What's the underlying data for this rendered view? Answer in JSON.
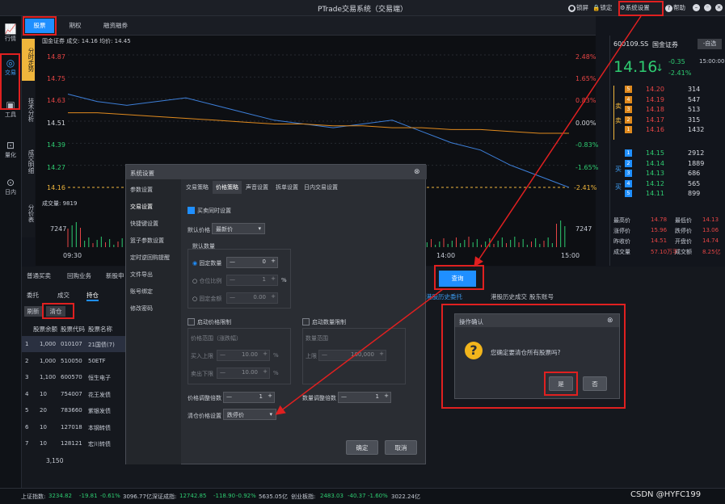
{
  "titlebar": {
    "title": "PTrade交易系统（交易端）",
    "menu": [
      "锁屏",
      "锁定",
      "系统设置",
      "帮助"
    ]
  },
  "leftbar": {
    "items": [
      "行情",
      "交易",
      "工具",
      "量化",
      "日内"
    ]
  },
  "subtabs": [
    "股票",
    "期权",
    "融资融券"
  ],
  "vtabs": [
    "分时走势",
    "技术分析",
    "成交明细",
    "分价表"
  ],
  "chart": {
    "legend": "国金证券 成交: 14.16 均价: 14.45",
    "yticks": [
      "14.87",
      "14.75",
      "14.63",
      "14.51",
      "14.39",
      "14.27",
      "14.16"
    ],
    "pct": [
      "2.48%",
      "1.65%",
      "0.83%",
      "0.00%",
      "-0.83%",
      "-1.65%",
      "-2.41%"
    ],
    "vol_label": "成交量: 9819",
    "vol_tick": "7247",
    "xticks": [
      "09:30",
      "14:00",
      "15:00"
    ],
    "chart_data": {
      "type": "line",
      "series": [
        {
          "values": [
            14.66,
            14.62,
            14.6,
            14.62,
            14.64,
            14.6,
            14.56,
            14.52,
            14.5,
            14.48,
            14.5,
            14.52,
            14.46,
            14.4,
            14.36,
            14.28,
            14.22,
            14.16
          ]
        },
        {
          "values": [
            14.56,
            14.56,
            14.55,
            14.54,
            14.53,
            14.52,
            14.51,
            14.5,
            14.5,
            14.49,
            14.49,
            14.48,
            14.48,
            14.47,
            14.47,
            14.46,
            14.45,
            14.45
          ]
        }
      ]
    }
  },
  "quote": {
    "code": "600109.SS",
    "name": "国金证券",
    "watch": "-自选",
    "price": "14.16",
    "chg": "-0.35",
    "pct": "-2.41%",
    "time": "15:00:00",
    "asks": [
      [
        "5",
        "14.20",
        "314"
      ],
      [
        "4",
        "14.19",
        "547"
      ],
      [
        "3",
        "14.18",
        "513"
      ],
      [
        "2",
        "14.17",
        "315"
      ],
      [
        "1",
        "14.16",
        "1432"
      ]
    ],
    "bids": [
      [
        "1",
        "14.15",
        "2912"
      ],
      [
        "2",
        "14.14",
        "1889"
      ],
      [
        "3",
        "14.13",
        "686"
      ],
      [
        "4",
        "14.12",
        "565"
      ],
      [
        "5",
        "14.11",
        "899"
      ]
    ],
    "sell_label": "卖",
    "buy_label": "买",
    "stats": [
      [
        "最高价",
        "14.78",
        "最低价",
        "14.13"
      ],
      [
        "涨停价",
        "15.96",
        "跌停价",
        "13.06"
      ],
      [
        "昨收价",
        "14.51",
        "开盘价",
        "14.74"
      ],
      [
        "成交量",
        "57.10万手",
        "成交额",
        "8.25亿"
      ]
    ]
  },
  "bottom": {
    "tabs1": [
      "普通买卖",
      "回购业务",
      "新股申"
    ],
    "tabs2": [
      "委托",
      "成交",
      "持仓"
    ],
    "actions": [
      "刷新",
      "清仓"
    ],
    "right_tabs": [
      "查询",
      "港股历史委托",
      "港股历史成交",
      "股东账号"
    ],
    "cols": [
      "股票余额",
      "股票代码",
      "股票名称"
    ],
    "rows": [
      [
        "1",
        "1,000",
        "010107",
        "21国债(7)"
      ],
      [
        "2",
        "1,000",
        "510050",
        "50ETF"
      ],
      [
        "3",
        "1,100",
        "600570",
        "恒生电子"
      ],
      [
        "4",
        "10",
        "754007",
        "花王发债"
      ],
      [
        "5",
        "20",
        "783660",
        "紫银发债"
      ],
      [
        "6",
        "10",
        "127018",
        "本钢转债"
      ],
      [
        "7",
        "10",
        "128121",
        "宏川转债"
      ]
    ],
    "total": "3,150"
  },
  "dialog": {
    "title": "系统设置",
    "menu": [
      "参数设置",
      "交易设置",
      "快捷键设置",
      "篮子参数设置",
      "定时逆回购提醒",
      "文件导出",
      "账号绑定",
      "修改密码"
    ],
    "tabs": [
      "交易策略",
      "价格策略",
      "声音设置",
      "拆单设置",
      "日内交易设置"
    ],
    "buy_sell_setting": "买卖同时设置",
    "default_price_label": "默认价格",
    "default_price": "最新价",
    "default_qty": "默认数量",
    "fixed_qty": "固定数量",
    "fixed_qty_val": "0",
    "pos_ratio": "仓位比例",
    "pos_ratio_val": "1",
    "pct": "%",
    "fixed_amt": "固定金额",
    "fixed_amt_val": "0.00",
    "price_limit": "启动价格限制",
    "price_range": "价格范围（涨跌幅）",
    "buy_cap": "买入上限",
    "buy_cap_val": "10.00",
    "sell_floor": "卖出下限",
    "sell_floor_val": "10.00",
    "qty_limit": "启动数量限制",
    "qty_range": "数量范围",
    "cap": "上限",
    "cap_val": "100,000",
    "price_mult": "价格调整倍数",
    "price_mult_val": "1",
    "qty_mult": "数量调整倍数",
    "qty_mult_val": "1",
    "clear_price": "清仓价格设置",
    "clear_price_val": "跌停价",
    "ok": "确定",
    "cancel": "取消"
  },
  "confirm": {
    "title": "操作确认",
    "msg": "您确定要清仓所有股票吗?",
    "yes": "是",
    "no": "否"
  },
  "status": {
    "sh": "上证指数:",
    "sh_val": "3234.82",
    "sh_chg": "-19.81",
    "sh_pct": "-0.61%",
    "sh_amt": "3096.77亿",
    "sz": "深证成指:",
    "sz_val": "12742.85",
    "sz_chg": "-118.90",
    "sz_pct": "-0.92%",
    "sz_amt": "5635.05亿",
    "cy": "创业板指:",
    "cy_val": "2483.03",
    "cy_chg": "-40.37",
    "cy_pct": "-1.60%",
    "cy_amt": "3022.24亿",
    "watermark": "CSDN @HYFC199"
  }
}
